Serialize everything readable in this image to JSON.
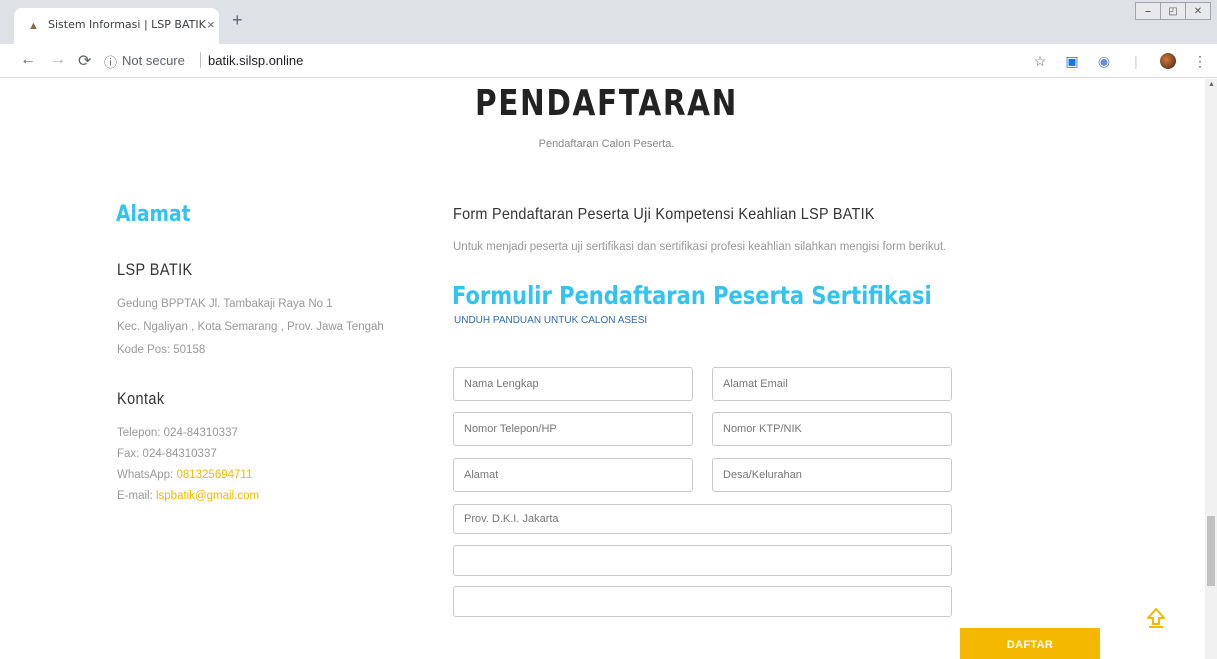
{
  "browser": {
    "tab_title": "Sistem Informasi | LSP BATIK",
    "tab_close": "×",
    "new_tab": "+",
    "not_secure": "Not secure",
    "url": "batik.silsp.online",
    "window_buttons": [
      "⎯",
      "◰",
      "✕"
    ]
  },
  "page": {
    "title": "PENDAFTARAN",
    "subtitle": "Pendaftaran Calon Peserta."
  },
  "sidebar": {
    "alamat_heading": "Alamat",
    "org_name": "LSP BATIK",
    "address_lines": [
      "Gedung BPPTAK Jl. Tambakaji Raya No 1",
      "Kec. Ngaliyan , Kota Semarang , Prov. Jawa Tengah",
      "Kode Pos: 50158"
    ],
    "kontak_heading": "Kontak",
    "telepon": "Telepon: 024-84310337",
    "fax": "Fax: 024-84310337",
    "whatsapp_label": "WhatsApp: ",
    "whatsapp_value": "081325694711",
    "email_label": "E-mail: ",
    "email_value": "lspbatik@gmail.com"
  },
  "form": {
    "heading": "Form Pendaftaran Peserta Uji Kompetensi Keahlian LSP BATIK",
    "description": "Untuk menjadi peserta uji sertifikasi dan sertifikasi profesi keahlian silahkan mengisi form berikut.",
    "title": "Formulir Pendaftaran Peserta Sertifikasi",
    "guide_link": "UNDUH PANDUAN UNTUK CALON ASESI",
    "placeholders": {
      "nama": "Nama Lengkap",
      "email": "Alamat Email",
      "telepon": "Nomor Telepon/HP",
      "ktp": "Nomor KTP/NIK",
      "alamat": "Alamat",
      "desa": "Desa/Kelurahan",
      "provinsi": "Prov. D.K.I. Jakarta",
      "extra1": "",
      "extra2": ""
    },
    "submit_label": "DAFTAR"
  },
  "colors": {
    "accent_blue": "#33c3f0",
    "accent_yellow": "#f5b800"
  }
}
